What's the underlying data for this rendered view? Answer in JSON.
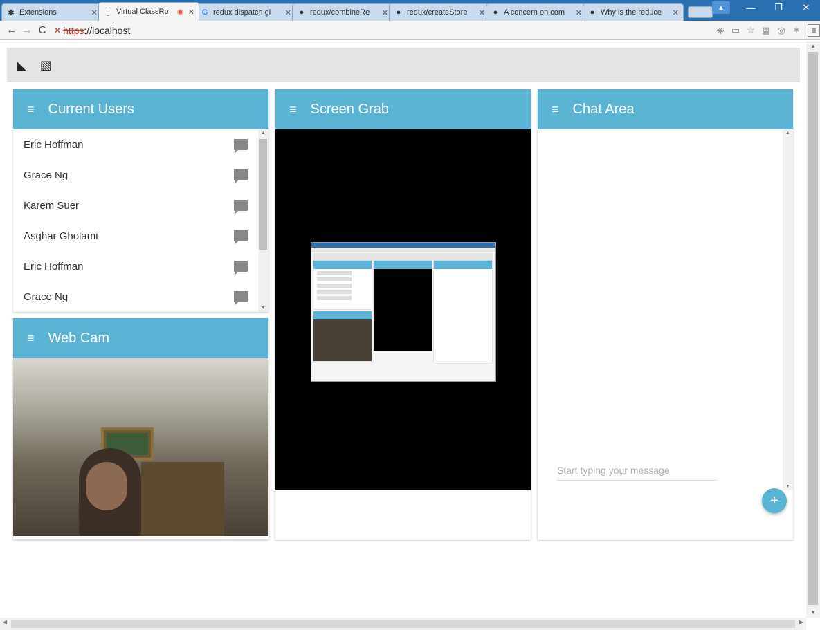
{
  "browser": {
    "tabs": [
      {
        "title": "Extensions",
        "icon": "puzzle-icon",
        "active": false
      },
      {
        "title": "Virtual ClassRo",
        "icon": "page-icon",
        "active": true,
        "recording": true
      },
      {
        "title": "redux dispatch gi",
        "icon": "google-icon",
        "active": false
      },
      {
        "title": "redux/combineRe",
        "icon": "github-icon",
        "active": false
      },
      {
        "title": "redux/createStore",
        "icon": "github-icon",
        "active": false
      },
      {
        "title": "A concern on com",
        "icon": "github-icon",
        "active": false
      },
      {
        "title": "Why is the reduce",
        "icon": "github-icon",
        "active": false
      }
    ],
    "url_scheme": "https",
    "url_rest": "://localhost"
  },
  "users": {
    "title": "Current Users",
    "items": [
      {
        "name": "Eric Hoffman"
      },
      {
        "name": "Grace Ng"
      },
      {
        "name": "Karem Suer"
      },
      {
        "name": "Asghar Gholami"
      },
      {
        "name": "Eric Hoffman"
      },
      {
        "name": "Grace Ng"
      }
    ]
  },
  "webcam": {
    "title": "Web Cam"
  },
  "grab": {
    "title": "Screen Grab"
  },
  "chat": {
    "title": "Chat Area",
    "placeholder": "Start typing your message",
    "send_icon": "+"
  },
  "colors": {
    "header_blue": "#5bb4d4",
    "tabstrip": "#2a6fb0"
  }
}
